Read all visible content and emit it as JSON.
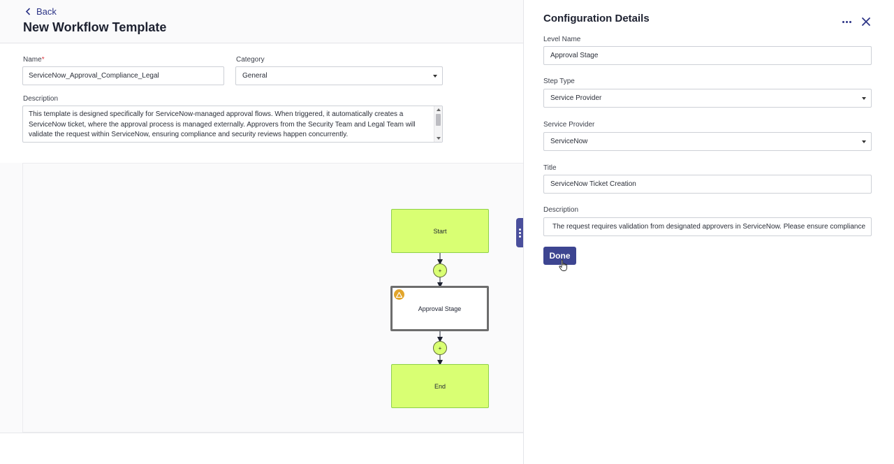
{
  "header": {
    "back_label": "Back",
    "page_title": "New Workflow Template"
  },
  "form": {
    "name_label": "Name",
    "required_mark": "*",
    "name_value": "ServiceNow_Approval_Compliance_Legal",
    "category_label": "Category",
    "category_value": "General",
    "description_label": "Description",
    "description_value": "This template is designed specifically for ServiceNow-managed approval flows. When triggered, it automatically creates a ServiceNow ticket, where the approval process is managed externally. Approvers from the Security Team and Legal Team will validate the request within ServiceNow, ensuring compliance and security reviews happen concurrently."
  },
  "workflow": {
    "nodes": [
      {
        "label": "Start",
        "type": "start"
      },
      {
        "label": "Approval Stage",
        "type": "stage",
        "warning": true
      },
      {
        "label": "End",
        "type": "end"
      }
    ],
    "add_symbol": "+"
  },
  "panel": {
    "title": "Configuration Details",
    "level_name_label": "Level Name",
    "level_name_value": "Approval Stage",
    "step_type_label": "Step Type",
    "step_type_value": "Service Provider",
    "service_provider_label": "Service Provider",
    "service_provider_value": "ServiceNow",
    "title_label": "Title",
    "title_value": "ServiceNow Ticket Creation",
    "description_label": "Description",
    "description_value": "The request requires validation from designated approvers in ServiceNow. Please ensure compliance",
    "done_label": "Done"
  },
  "colors": {
    "accent": "#3d4591",
    "node_green": "#d9ff73",
    "warning": "#e2a52b"
  },
  "icons": [
    "chevron-left-icon",
    "more-horizontal-icon",
    "close-icon",
    "warning-icon",
    "drag-handle-icon",
    "pointer-cursor-icon"
  ]
}
